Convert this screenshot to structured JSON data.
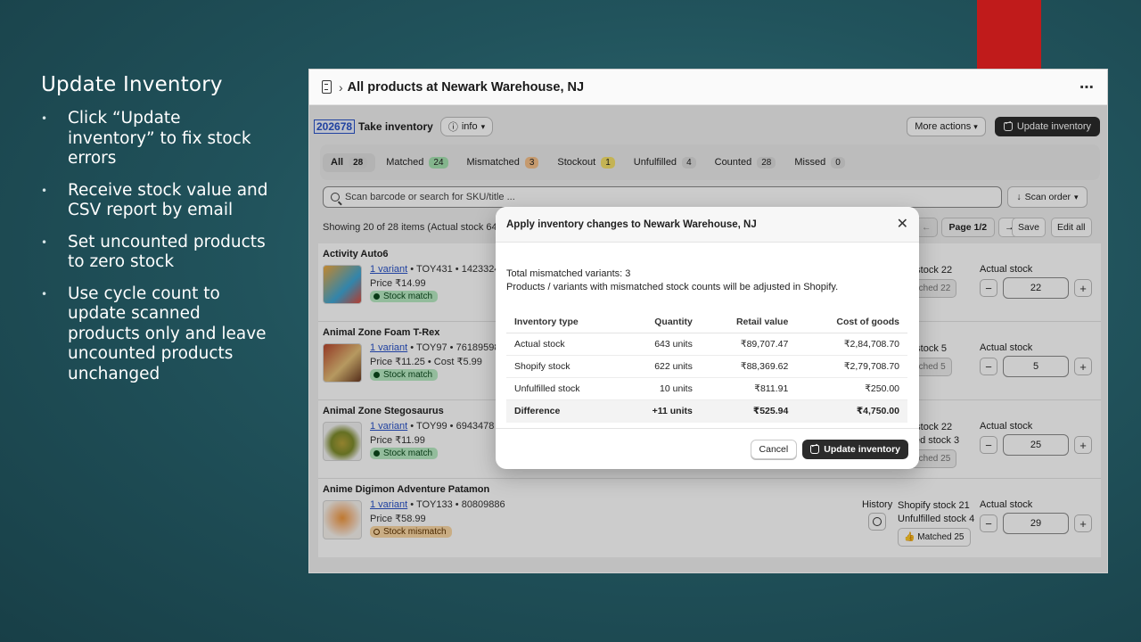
{
  "slide": {
    "title": "Update Inventory",
    "bullets": [
      "Click “Update inventory” to fix stock errors",
      "Receive stock value and CSV report by email",
      "Set uncounted products to zero stock",
      "Use cycle count to update scanned products only and leave uncounted products unchanged"
    ]
  },
  "app": {
    "crumb_sep": "›",
    "title": "All products at Newark Warehouse, NJ",
    "menu_dots": "⋯",
    "inventory_id": "202678",
    "take_inventory": "Take inventory",
    "info_label": "info",
    "more_actions": "More actions",
    "update_inventory": "Update inventory",
    "tabs": [
      {
        "label": "All",
        "count": "28"
      },
      {
        "label": "Matched",
        "count": "24"
      },
      {
        "label": "Mismatched",
        "count": "3"
      },
      {
        "label": "Stockout",
        "count": "1"
      },
      {
        "label": "Unfulfilled",
        "count": "4"
      },
      {
        "label": "Counted",
        "count": "28"
      },
      {
        "label": "Missed",
        "count": "0"
      }
    ],
    "search_placeholder": "Scan barcode or search for SKU/title ...",
    "scan_order": "Scan order",
    "showing": "Showing 20 of 28 items (Actual stock 643",
    "pager": {
      "prev": "←",
      "page": "Page 1/2",
      "next": "→"
    },
    "save": "Save",
    "edit_all": "Edit all",
    "products": [
      {
        "name": "Activity Auto6",
        "variant": "1 variant",
        "meta": " • TOY431 • 14233242",
        "price": "Price ₹14.99",
        "status": "Stock match",
        "shopify": "pify stock 22",
        "unfulfilled": "",
        "matched": "Matched 22",
        "actual_label": "Actual stock",
        "actual": "22"
      },
      {
        "name": "Animal Zone Foam T-Rex",
        "variant": "1 variant",
        "meta": " • TOY97 • 76189598",
        "price": "Price ₹11.25 • Cost ₹5.99",
        "status": "Stock match",
        "shopify": "pify stock 5",
        "unfulfilled": "",
        "matched": "Matched 5",
        "actual_label": "Actual stock",
        "actual": "5"
      },
      {
        "name": "Animal Zone Stegosaurus",
        "variant": "1 variant",
        "meta": " • TOY99 • 6943478",
        "price": "Price ₹11.99",
        "status": "Stock match",
        "shopify": "pify stock 22",
        "unfulfilled": "ulfilled stock 3",
        "matched": "Matched 25",
        "actual_label": "Actual stock",
        "actual": "25"
      },
      {
        "name": "Anime Digimon Adventure Patamon",
        "variant": "1 variant",
        "meta": " • TOY133 • 80809886",
        "price": "Price ₹58.99",
        "status": "Stock mismatch",
        "history": "History",
        "shopify": "Shopify stock 21",
        "unfulfilled": "Unfulfilled stock 4",
        "matched": "Matched 25",
        "actual_label": "Actual stock",
        "actual": "29"
      }
    ]
  },
  "modal": {
    "title": "Apply inventory changes to Newark Warehouse, NJ",
    "close": "✕",
    "line1": "Total mismatched variants: 3",
    "line2": "Products / variants with mismatched stock counts will be adjusted in Shopify.",
    "columns": [
      "Inventory type",
      "Quantity",
      "Retail value",
      "Cost of goods"
    ],
    "rows": [
      [
        "Actual stock",
        "643 units",
        "₹89,707.47",
        "₹2,84,708.70"
      ],
      [
        "Shopify stock",
        "622 units",
        "₹88,369.62",
        "₹2,79,708.70"
      ],
      [
        "Unfulfilled stock",
        "10 units",
        "₹811.91",
        "₹250.00"
      ],
      [
        "Difference",
        "+11 units",
        "₹525.94",
        "₹4,750.00"
      ]
    ],
    "cancel": "Cancel",
    "confirm": "Update inventory"
  }
}
